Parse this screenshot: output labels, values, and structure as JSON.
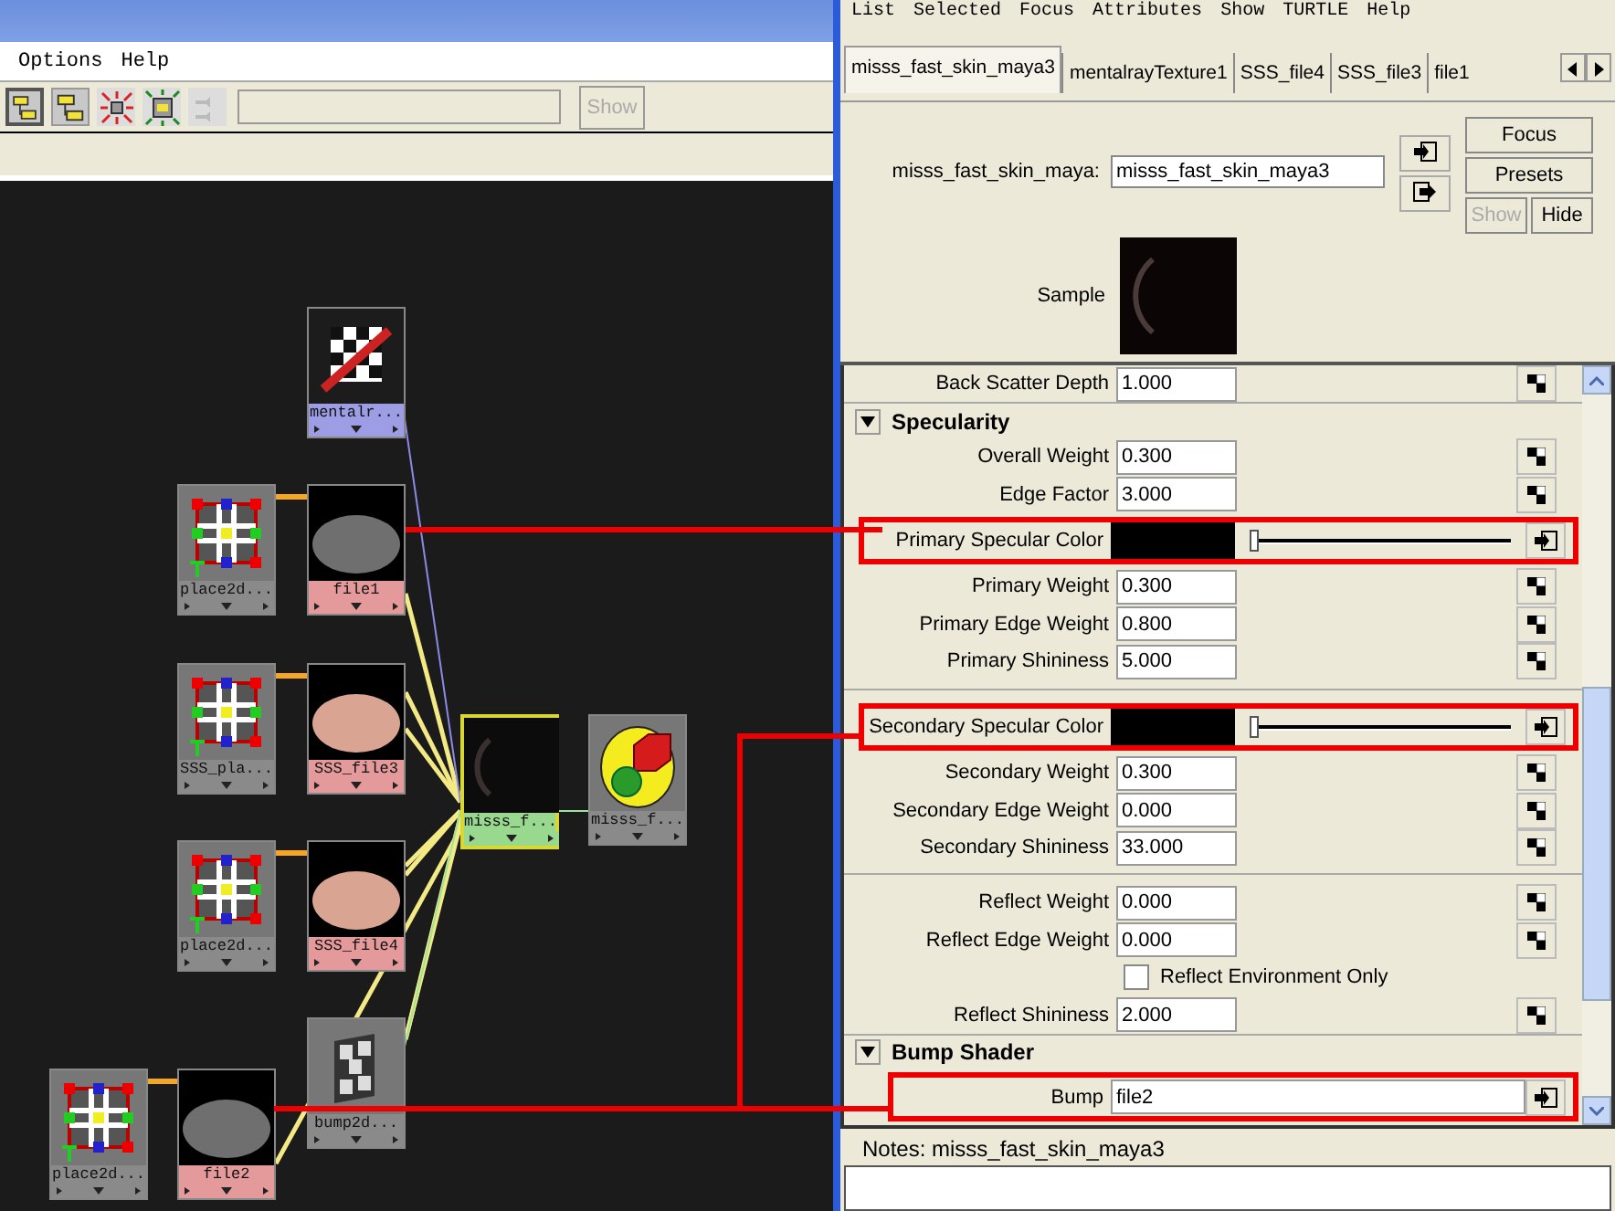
{
  "left_window": {
    "menu": [
      "Options",
      "Help"
    ],
    "toolbar": {
      "filter_field": {
        "disabled": true
      },
      "show_button": {
        "label": "Show",
        "disabled": true
      }
    }
  },
  "graph": {
    "nodes": [
      {
        "label": "mentalr...",
        "kind": "texture",
        "selected": false
      },
      {
        "label": "place2d...",
        "kind": "place2d",
        "selected": false
      },
      {
        "label": "file1",
        "kind": "file",
        "selected": false
      },
      {
        "label": "SSS_pla...",
        "kind": "place2d",
        "selected": false
      },
      {
        "label": "SSS_file3",
        "kind": "file",
        "selected": false
      },
      {
        "label": "place2d...",
        "kind": "place2d",
        "selected": false
      },
      {
        "label": "SSS_file4",
        "kind": "file",
        "selected": false
      },
      {
        "label": "place2d...",
        "kind": "place2d",
        "selected": false
      },
      {
        "label": "file2",
        "kind": "file",
        "selected": false
      },
      {
        "label": "bump2d...",
        "kind": "bump",
        "selected": false
      },
      {
        "label": "misss_f...",
        "kind": "shader",
        "selected": true
      },
      {
        "label": "misss_f...",
        "kind": "group",
        "selected": false
      }
    ]
  },
  "attribute_editor": {
    "menu": [
      "List",
      "Selected",
      "Focus",
      "Attributes",
      "Show",
      "TURTLE",
      "Help"
    ],
    "tabs": [
      {
        "label": "misss_fast_skin_maya3",
        "selected": true
      },
      {
        "label": "mentalrayTexture1",
        "selected": false
      },
      {
        "label": "SSS_file4",
        "selected": false
      },
      {
        "label": "SSS_file3",
        "selected": false
      },
      {
        "label": "file1",
        "selected": false
      }
    ],
    "node_field": {
      "label": "misss_fast_skin_maya:",
      "value": "misss_fast_skin_maya3"
    },
    "buttons": [
      {
        "label": "Focus",
        "disabled": false
      },
      {
        "label": "Presets",
        "disabled": false
      },
      {
        "label": "Show",
        "disabled": true
      },
      {
        "label": "Hide",
        "disabled": false
      }
    ],
    "sample_label": "Sample",
    "rows": [
      {
        "kind": "number",
        "label": "Back Scatter Depth",
        "value": "1.000",
        "highlighted": false
      },
      {
        "kind": "section",
        "label": "Specularity",
        "expanded": true
      },
      {
        "kind": "number",
        "label": "Overall Weight",
        "value": "0.300",
        "highlighted": false
      },
      {
        "kind": "number",
        "label": "Edge Factor",
        "value": "3.000",
        "highlighted": false
      },
      {
        "kind": "color",
        "label": "Primary Specular Color",
        "color": "#000000",
        "level": 0,
        "highlighted": true
      },
      {
        "kind": "number",
        "label": "Primary Weight",
        "value": "0.300",
        "highlighted": false
      },
      {
        "kind": "number",
        "label": "Primary Edge Weight",
        "value": "0.800",
        "highlighted": false
      },
      {
        "kind": "number",
        "label": "Primary Shininess",
        "value": "5.000",
        "highlighted": false
      },
      {
        "kind": "divider"
      },
      {
        "kind": "color",
        "label": "Secondary Specular Color",
        "color": "#000000",
        "level": 0,
        "highlighted": true
      },
      {
        "kind": "number",
        "label": "Secondary Weight",
        "value": "0.300",
        "highlighted": false
      },
      {
        "kind": "number",
        "label": "Secondary Edge Weight",
        "value": "0.000",
        "highlighted": false
      },
      {
        "kind": "number",
        "label": "Secondary Shininess",
        "value": "33.000",
        "highlighted": false
      },
      {
        "kind": "divider"
      },
      {
        "kind": "number",
        "label": "Reflect Weight",
        "value": "0.000",
        "highlighted": false
      },
      {
        "kind": "number",
        "label": "Reflect Edge Weight",
        "value": "0.000",
        "highlighted": false
      },
      {
        "kind": "checkbox",
        "label": "Reflect Environment Only",
        "checked": false,
        "highlighted": false
      },
      {
        "kind": "number",
        "label": "Reflect Shininess",
        "value": "2.000",
        "highlighted": false
      },
      {
        "kind": "section",
        "label": "Bump Shader",
        "expanded": true
      },
      {
        "kind": "link",
        "label": "Bump",
        "value": "file2",
        "highlighted": true
      }
    ],
    "notes": {
      "label": "Notes:  misss_fast_skin_maya3"
    }
  }
}
